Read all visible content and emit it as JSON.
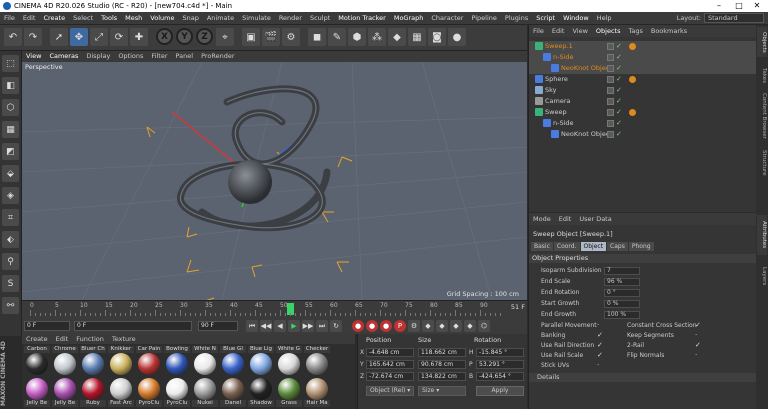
{
  "window": {
    "title": "CINEMA 4D R20.026 Studio (RC - R20) - [new704.c4d *] - Main",
    "min": "–",
    "max": "□",
    "close": "✕"
  },
  "menu": [
    "File",
    "Edit",
    "Create",
    "Select",
    "Tools",
    "Mesh",
    "Volume",
    "Snap",
    "Animate",
    "Simulate",
    "Render",
    "Sculpt",
    "Motion Tracker",
    "MoGraph",
    "Character",
    "Pipeline",
    "Plugins",
    "Script",
    "Window",
    "Help"
  ],
  "menu_highlight": [
    "Create",
    "Tools",
    "Mesh",
    "Volume",
    "Motion Tracker",
    "MoGraph",
    "Script",
    "Window"
  ],
  "layout": {
    "label": "Layout:",
    "value": "Standard"
  },
  "toolbar": [
    "undo",
    "redo",
    "select",
    "move",
    "scale",
    "rotate",
    "recent",
    "x",
    "y",
    "z",
    "coord",
    "render-view",
    "render",
    "render-settings",
    "cube",
    "pen",
    "subdiv",
    "cloner",
    "deformer",
    "scene",
    "camera",
    "light"
  ],
  "viewport": {
    "menu": [
      "View",
      "Cameras",
      "Display",
      "Options",
      "Filter",
      "Panel",
      "ProRender"
    ],
    "menu_highlight": [
      "View",
      "Cameras"
    ],
    "label": "Perspective",
    "grid_spacing": "Grid Spacing : 100 cm"
  },
  "timeline": {
    "ticks": [
      "0",
      "5",
      "10",
      "15",
      "20",
      "25",
      "30",
      "35",
      "40",
      "45",
      "50",
      "55",
      "60",
      "65",
      "70",
      "75",
      "80",
      "85",
      "90"
    ],
    "current": "52",
    "end": "51 F"
  },
  "transport": {
    "start": "0 F",
    "current": "0 F",
    "max": "90 F",
    "end": "90 F"
  },
  "materials": {
    "menu": [
      "Create",
      "Edit",
      "Function",
      "Texture"
    ],
    "row1": [
      {
        "name": "Carbon",
        "color": "#2a2a2a"
      },
      {
        "name": "Chrome",
        "color": "#c0c6cc"
      },
      {
        "name": "Bluer Ch",
        "color": "#5a7bb0"
      },
      {
        "name": "Knikker",
        "color": "#c9b15c"
      },
      {
        "name": "Car Pain",
        "color": "#b33"
      },
      {
        "name": "Bowling",
        "color": "#2f55b8"
      },
      {
        "name": "White N",
        "color": "#e8e8e8"
      },
      {
        "name": "Blue Gl",
        "color": "#3a63c9"
      },
      {
        "name": "Blue Lig",
        "color": "#7fa6e0"
      },
      {
        "name": "White G",
        "color": "#d8d8d8"
      },
      {
        "name": "Checker",
        "color": "#888"
      }
    ],
    "row2": [
      {
        "name": "Jelly Be",
        "color": "#c45cc4"
      },
      {
        "name": "Jelly Be",
        "color": "#a84fb0"
      },
      {
        "name": "Ruby",
        "color": "#b3152a"
      },
      {
        "name": "Fast Arc",
        "color": "#cfcfcf"
      },
      {
        "name": "PyroClu",
        "color": "#d47a2a"
      },
      {
        "name": "PyroClu",
        "color": "#ececec"
      },
      {
        "name": "Nukei",
        "color": "#9a9a9a"
      },
      {
        "name": "Danel",
        "color": "#7a6050"
      },
      {
        "name": "Shadow",
        "color": "#222"
      },
      {
        "name": "Grass",
        "color": "#5b8a3a"
      },
      {
        "name": "Hair Ma",
        "color": "#b09070"
      }
    ]
  },
  "coords": {
    "headers": [
      "Position",
      "Size",
      "Rotation"
    ],
    "rows": [
      {
        "axis": "X",
        "pos": "-4.648 cm",
        "size": "118.662 cm",
        "rlabel": "H",
        "rot": "-15.845 °"
      },
      {
        "axis": "Y",
        "pos": "165.642 cm",
        "size": "90.678 cm",
        "rlabel": "P",
        "rot": "53.291 °"
      },
      {
        "axis": "Z",
        "pos": "-72.674 cm",
        "size": "134.822 cm",
        "rlabel": "B",
        "rot": "-424.654 °"
      }
    ],
    "mode": "Object (Rel) ▾",
    "size_mode": "Size ▾",
    "apply": "Apply"
  },
  "objects": {
    "menu": [
      "File",
      "Edit",
      "View",
      "Objects",
      "Tags",
      "Bookmarks"
    ],
    "menu_highlight": "Objects",
    "items": [
      {
        "name": "Sweep.1",
        "indent": 0,
        "color": "#e08a1e",
        "icon": "sweep",
        "sel": true,
        "tag": true
      },
      {
        "name": "n-Side",
        "indent": 1,
        "color": "#e08a1e",
        "icon": "spline",
        "sel": true,
        "tag": false
      },
      {
        "name": "NeoKnot Object",
        "indent": 2,
        "color": "#e08a1e",
        "icon": "spline",
        "sel": true,
        "tag": false
      },
      {
        "name": "Sphere",
        "indent": 0,
        "color": "#ccc",
        "icon": "sphere",
        "sel": false,
        "tag": true
      },
      {
        "name": "Sky",
        "indent": 0,
        "color": "#ccc",
        "icon": "sky",
        "sel": false,
        "tag": false
      },
      {
        "name": "Camera",
        "indent": 0,
        "color": "#ccc",
        "icon": "camera",
        "sel": false,
        "tag": false
      },
      {
        "name": "Sweep",
        "indent": 0,
        "color": "#ccc",
        "icon": "sweep",
        "sel": false,
        "tag": true
      },
      {
        "name": "n-Side",
        "indent": 1,
        "color": "#ccc",
        "icon": "spline",
        "sel": false,
        "tag": false
      },
      {
        "name": "NeoKnot Object",
        "indent": 2,
        "color": "#ccc",
        "icon": "spline",
        "sel": false,
        "tag": false
      }
    ]
  },
  "attributes": {
    "menu": [
      "Mode",
      "Edit",
      "User Data"
    ],
    "title": "Sweep Object [Sweep.1]",
    "tabs": [
      "Basic",
      "Coord.",
      "Object",
      "Caps",
      "Phong"
    ],
    "active_tab": "Object",
    "section": "Object Properties",
    "fields": [
      {
        "label": "Isoparm Subdivision",
        "value": "7"
      },
      {
        "label": "End Scale",
        "value": "96 %"
      },
      {
        "label": "End Rotation",
        "value": "0 °"
      },
      {
        "label": "Start Growth",
        "value": "0 %"
      },
      {
        "label": "End Growth",
        "value": "100 %"
      }
    ],
    "checks_left": [
      {
        "label": "Parallel Movement",
        "on": false
      },
      {
        "label": "Banking",
        "on": true
      },
      {
        "label": "Use Rail Direction",
        "on": true
      },
      {
        "label": "Use Rail Scale",
        "on": true
      },
      {
        "label": "Stick UVs",
        "on": false
      }
    ],
    "checks_right": [
      {
        "label": "Constant Cross Section",
        "on": true
      },
      {
        "label": "Keep Segments",
        "on": false
      },
      {
        "label": "2-Rail",
        "on": true
      },
      {
        "label": "Flip Normals",
        "on": false
      }
    ],
    "details": "Details"
  },
  "sidetabs": [
    "Objects",
    "Takes",
    "Content Browser",
    "Structure",
    "Attributes",
    "Layers"
  ],
  "active_sidetabs": [
    "Objects",
    "Attributes"
  ],
  "brand": "MAXON CINEMA 4D"
}
